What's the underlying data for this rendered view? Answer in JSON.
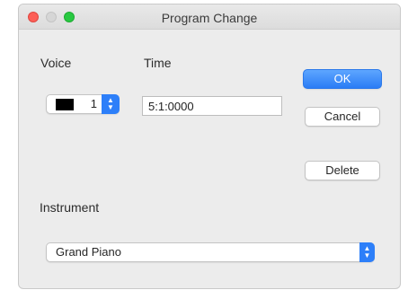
{
  "window": {
    "title": "Program Change"
  },
  "voice": {
    "label": "Voice",
    "value": "1",
    "swatch_color": "#000000"
  },
  "time": {
    "label": "Time",
    "value": "5:1:0000"
  },
  "buttons": {
    "ok": "OK",
    "cancel": "Cancel",
    "delete": "Delete"
  },
  "instrument": {
    "label": "Instrument",
    "value": "Grand Piano"
  },
  "colors": {
    "accent": "#2d7ff9",
    "close": "#fd5f57",
    "zoom": "#28c941"
  },
  "icons": {
    "stepper": "updown-chevron-icon"
  }
}
